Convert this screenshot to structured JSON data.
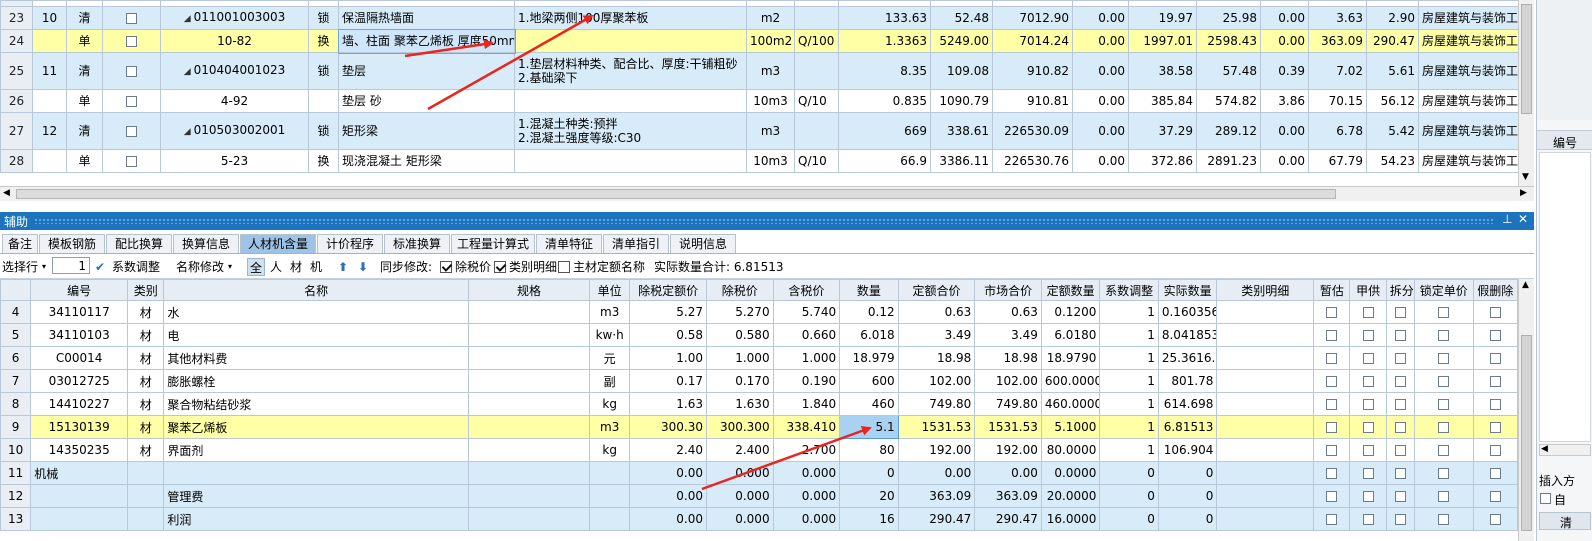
{
  "upper_rows": [
    {
      "rn": "23",
      "seq": "10",
      "type": "清",
      "code": "011001003003",
      "flag": "锁",
      "name": "保温隔热墙面",
      "feature": "1.地梁两侧100厚聚苯板",
      "unit": "m2",
      "mult": "",
      "qty": "133.63",
      "price": "52.48",
      "total": "7012.90",
      "c1": "0.00",
      "c2": "19.97",
      "c3": "25.98",
      "c4": "0.00",
      "c5": "3.63",
      "c6": "2.90",
      "major": "房屋建筑与装饰工",
      "style": "blue",
      "tri": true
    },
    {
      "rn": "24",
      "seq": "",
      "type": "单",
      "code": "10-82",
      "flag": "换",
      "name": "墙、柱面 聚苯乙烯板 厚度50mm",
      "feature": "",
      "unit": "100m2",
      "mult": "Q/100",
      "qty": "1.3363",
      "price": "5249.00",
      "total": "7014.24",
      "c1": "0.00",
      "c2": "1997.01",
      "c3": "2598.43",
      "c4": "0.00",
      "c5": "363.09",
      "c6": "290.47",
      "major": "房屋建筑与装饰工",
      "style": "yellow",
      "tri": false
    },
    {
      "rn": "25",
      "seq": "11",
      "type": "清",
      "code": "010404001023",
      "flag": "锁",
      "name": "垫层",
      "feature": "1.垫层材料种类、配合比、厚度:干铺粗砂\n2.基础梁下",
      "unit": "m3",
      "mult": "",
      "qty": "8.35",
      "price": "109.08",
      "total": "910.82",
      "c1": "0.00",
      "c2": "38.58",
      "c3": "57.48",
      "c4": "0.39",
      "c5": "7.02",
      "c6": "5.61",
      "major": "房屋建筑与装饰工",
      "style": "blue",
      "tri": true
    },
    {
      "rn": "26",
      "seq": "",
      "type": "单",
      "code": "4-92",
      "flag": "",
      "name": "垫层 砂",
      "feature": "",
      "unit": "10m3",
      "mult": "Q/10",
      "qty": "0.835",
      "price": "1090.79",
      "total": "910.81",
      "c1": "0.00",
      "c2": "385.84",
      "c3": "574.82",
      "c4": "3.86",
      "c5": "70.15",
      "c6": "56.12",
      "major": "房屋建筑与装饰工",
      "style": "white",
      "tri": false
    },
    {
      "rn": "27",
      "seq": "12",
      "type": "清",
      "code": "010503002001",
      "flag": "锁",
      "name": "矩形梁",
      "feature": "1.混凝土种类:预拌\n2.混凝土强度等级:C30",
      "unit": "m3",
      "mult": "",
      "qty": "669",
      "price": "338.61",
      "total": "226530.09",
      "c1": "0.00",
      "c2": "37.29",
      "c3": "289.12",
      "c4": "0.00",
      "c5": "6.78",
      "c6": "5.42",
      "major": "房屋建筑与装饰工",
      "style": "blue",
      "tri": true
    },
    {
      "rn": "28",
      "seq": "",
      "type": "单",
      "code": "5-23",
      "flag": "换",
      "name": "现浇混凝土 矩形梁",
      "feature": "",
      "unit": "10m3",
      "mult": "Q/10",
      "qty": "66.9",
      "price": "3386.11",
      "total": "226530.76",
      "c1": "0.00",
      "c2": "372.86",
      "c3": "2891.23",
      "c4": "0.00",
      "c5": "67.79",
      "c6": "54.23",
      "major": "房屋建筑与装饰工",
      "style": "white",
      "tri": false
    }
  ],
  "aux": {
    "title": "辅助",
    "pin": "⊥",
    "close": "✕",
    "tabs": [
      "备注",
      "模板钢筋",
      "配比换算",
      "换算信息",
      "人材机含量",
      "计价程序",
      "标准换算",
      "工程量计算式",
      "清单特征",
      "清单指引",
      "说明信息"
    ],
    "active_tab": 4
  },
  "toolbar": {
    "select_row": "选择行",
    "select_value": "1",
    "coef_adjust": "系数调整",
    "name_modify": "名称修改",
    "filters": [
      "全",
      "人",
      "材",
      "机"
    ],
    "sync_label": "同步修改:",
    "chk_ex_tax": "除税价",
    "chk_category": "类别明细",
    "chk_main": "主材定额名称",
    "total_label": "实际数量合计: 6.81513"
  },
  "lower_headers": [
    "",
    "编号",
    "类别",
    "名称",
    "规格",
    "单位",
    "除税定额价",
    "除税价",
    "含税价",
    "数量",
    "定额合价",
    "市场合价",
    "定额数量",
    "系数调整",
    "实际数量",
    "类别明细",
    "暂估",
    "甲供",
    "拆分",
    "锁定单价",
    "假删除"
  ],
  "lower_rows": [
    {
      "rn": "4",
      "code": "34110117",
      "cat": "材",
      "name": "水",
      "spec": "",
      "unit": "m3",
      "p1": "5.27",
      "p2": "5.270",
      "p3": "5.740",
      "qty": "0.12",
      "t1": "0.63",
      "t2": "0.63",
      "dq": "0.1200",
      "coef": "1",
      "act": "0.160356",
      "style": "white",
      "boxes": true
    },
    {
      "rn": "5",
      "code": "34110103",
      "cat": "材",
      "name": "电",
      "spec": "",
      "unit": "kw·h",
      "p1": "0.58",
      "p2": "0.580",
      "p3": "0.660",
      "qty": "6.018",
      "t1": "3.49",
      "t2": "3.49",
      "dq": "6.0180",
      "coef": "1",
      "act": "8.041853",
      "style": "white",
      "boxes": true
    },
    {
      "rn": "6",
      "code": "C00014",
      "cat": "材",
      "name": "其他材料费",
      "spec": "",
      "unit": "元",
      "p1": "1.00",
      "p2": "1.000",
      "p3": "1.000",
      "qty": "18.979",
      "t1": "18.98",
      "t2": "18.98",
      "dq": "18.9790",
      "coef": "1",
      "act": "25.3616...",
      "style": "white",
      "boxes": true
    },
    {
      "rn": "7",
      "code": "03012725",
      "cat": "材",
      "name": "膨胀螺栓",
      "spec": "",
      "unit": "副",
      "p1": "0.17",
      "p2": "0.170",
      "p3": "0.190",
      "qty": "600",
      "t1": "102.00",
      "t2": "102.00",
      "dq": "600.0000",
      "coef": "1",
      "act": "801.78",
      "style": "white",
      "boxes": true
    },
    {
      "rn": "8",
      "code": "14410227",
      "cat": "材",
      "name": "聚合物粘结砂浆",
      "spec": "",
      "unit": "kg",
      "p1": "1.63",
      "p2": "1.630",
      "p3": "1.840",
      "qty": "460",
      "t1": "749.80",
      "t2": "749.80",
      "dq": "460.0000",
      "coef": "1",
      "act": "614.698",
      "style": "white",
      "boxes": true
    },
    {
      "rn": "9",
      "code": "15130139",
      "cat": "材",
      "name": "聚苯乙烯板",
      "spec": "",
      "unit": "m3",
      "p1": "300.30",
      "p2": "300.300",
      "p3": "338.410",
      "qty": "5.1",
      "t1": "1531.53",
      "t2": "1531.53",
      "dq": "5.1000",
      "coef": "1",
      "act": "6.81513",
      "style": "yellow",
      "boxes": true
    },
    {
      "rn": "10",
      "code": "14350235",
      "cat": "材",
      "name": "界面剂",
      "spec": "",
      "unit": "kg",
      "p1": "2.40",
      "p2": "2.400",
      "p3": "2.700",
      "qty": "80",
      "t1": "192.00",
      "t2": "192.00",
      "dq": "80.0000",
      "coef": "1",
      "act": "106.904",
      "style": "white",
      "boxes": true
    },
    {
      "rn": "11",
      "code": "机械",
      "cat": "",
      "name": "",
      "spec": "",
      "unit": "",
      "p1": "0.00",
      "p2": "0.000",
      "p3": "0.000",
      "qty": "0",
      "t1": "0.00",
      "t2": "0.00",
      "dq": "0.0000",
      "coef": "0",
      "act": "0",
      "style": "blue",
      "boxes": true
    },
    {
      "rn": "12",
      "code": "",
      "cat": "",
      "name": "管理费",
      "spec": "",
      "unit": "",
      "p1": "0.00",
      "p2": "0.000",
      "p3": "0.000",
      "qty": "20",
      "t1": "363.09",
      "t2": "363.09",
      "dq": "20.0000",
      "coef": "0",
      "act": "0",
      "style": "blue",
      "boxes": true
    },
    {
      "rn": "13",
      "code": "",
      "cat": "",
      "name": "利润",
      "spec": "",
      "unit": "",
      "p1": "0.00",
      "p2": "0.000",
      "p3": "0.000",
      "qty": "16",
      "t1": "290.47",
      "t2": "290.47",
      "dq": "16.0000",
      "coef": "0",
      "act": "0",
      "style": "blue",
      "boxes": true
    }
  ],
  "right_panel": {
    "code_label": "编号",
    "insert_label": "插入方",
    "auto_label": "自",
    "bottom_label": "清"
  },
  "colors": {
    "accent": "#1c73be",
    "row_blue": "#d7ebf8",
    "row_yellow": "#ffffa6",
    "arrow": "#e8251f"
  }
}
